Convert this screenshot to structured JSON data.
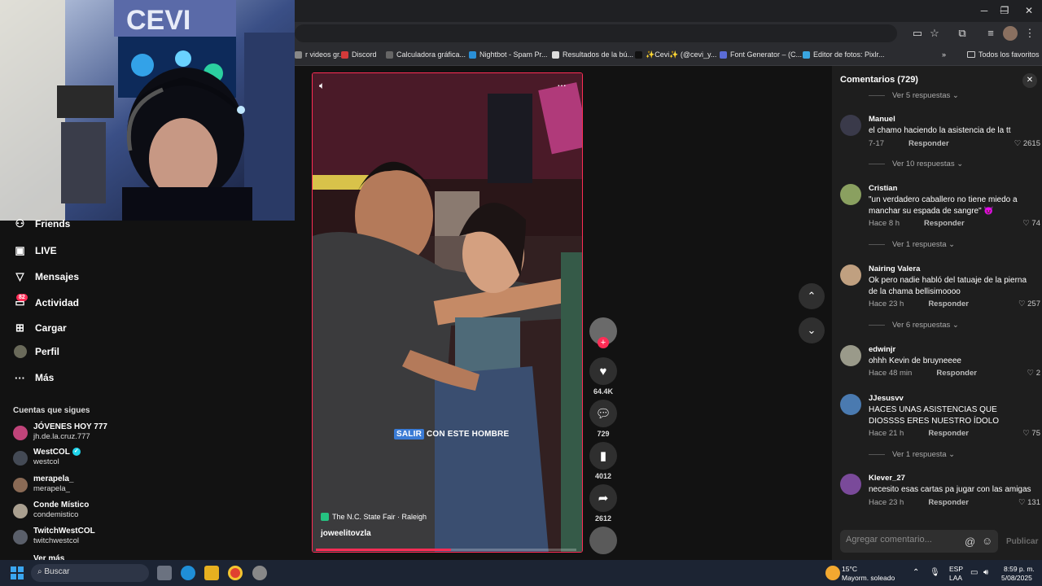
{
  "browser": {
    "bookmarks": [
      {
        "label": "r videos gr...",
        "color": "#888888"
      },
      {
        "label": "Discord",
        "color": "#d33a3a"
      },
      {
        "label": "Calculadora gráfica...",
        "color": "#666666"
      },
      {
        "label": "Nightbot - Spam Pr...",
        "color": "#2a8fd6"
      },
      {
        "label": "Resultados de la bú...",
        "color": "#dddddd"
      },
      {
        "label": "✨Cevi✨ (@cevi_y...",
        "color": "#111111"
      },
      {
        "label": "Font Generator – (C...",
        "color": "#5b6cd6"
      },
      {
        "label": "Editor de fotos: Pixlr...",
        "color": "#3aa6e0"
      }
    ],
    "all_favorites": "Todos los favoritos"
  },
  "sidebar": {
    "nav": [
      {
        "label": "Friends",
        "icon": "friends-icon",
        "glyph": "👥"
      },
      {
        "label": "LIVE",
        "icon": "live-icon",
        "glyph": "▣"
      },
      {
        "label": "Mensajes",
        "icon": "messages-icon",
        "glyph": "✈"
      },
      {
        "label": "Actividad",
        "icon": "activity-icon",
        "glyph": "▭"
      },
      {
        "label": "Cargar",
        "icon": "upload-icon",
        "glyph": "⊞"
      },
      {
        "label": "Perfil",
        "icon": "profile-icon",
        "glyph": "●"
      },
      {
        "label": "Más",
        "icon": "more-icon",
        "glyph": "···"
      }
    ],
    "activity_badge": "82",
    "following_title": "Cuentas que sigues",
    "following": [
      {
        "name": "JÓVENES HOY 777",
        "handle": "jh.de.la.cruz.777",
        "verified": false,
        "color": "#c0447a"
      },
      {
        "name": "WestCOL",
        "handle": "westcol",
        "verified": true,
        "color": "#444a55"
      },
      {
        "name": "merapela_",
        "handle": "merapela_",
        "verified": false,
        "color": "#8a6a55"
      },
      {
        "name": "Conde Místico",
        "handle": "condemistico",
        "verified": false,
        "color": "#aaa090"
      },
      {
        "name": "TwitchWestCOL",
        "handle": "twitchwestcol",
        "verified": false,
        "color": "#5a5f6a"
      },
      {
        "name": "Ver más",
        "handle": "",
        "verified": false,
        "color": "#121212"
      }
    ]
  },
  "video": {
    "caption_highlight": "SALIR",
    "caption_rest": " CON ESTE HOMBRE",
    "location": "The N.C. State Fair · Raleigh",
    "username": "joweelitovzla",
    "progress": 0.52,
    "actions": {
      "likes": "64.4K",
      "comments": "729",
      "saves": "4012",
      "shares": "2612"
    }
  },
  "comments_panel": {
    "title": "Comentarios (729)",
    "input_placeholder": "Agregar comentario...",
    "post_label": "Publicar",
    "reply_label": "Responder",
    "top_replies": "Ver 5 respuestas",
    "comments": [
      {
        "user": "Manuel",
        "text": "el chamo haciendo la asistencia de la tt",
        "time": "7-17",
        "likes": "2615",
        "replies": "Ver 10 respuestas",
        "color": "#3a3a4a"
      },
      {
        "user": "Cristian",
        "text": "\"un verdadero caballero no tiene miedo a manchar su espada de sangre\" 😈",
        "time": "Hace 8 h",
        "likes": "74",
        "replies": "Ver 1 respuesta",
        "color": "#8aa060"
      },
      {
        "user": "Nairing Valera",
        "text": "Ok pero nadie habló del tatuaje de la pierna de la chama bellisimoooo",
        "time": "Hace 23 h",
        "likes": "257",
        "replies": "Ver 6 respuestas",
        "color": "#c0a080"
      },
      {
        "user": "edwinjr",
        "text": "ohhh Kevin de bruyneeee",
        "time": "Hace 48 min",
        "likes": "2",
        "replies": "",
        "color": "#9a9a8a"
      },
      {
        "user": "JJesusvv",
        "text": "HACES UNAS ASISTENCIAS QUE DIOSSSS ERES NUESTRO ÍDOLO",
        "time": "Hace 21 h",
        "likes": "75",
        "replies": "Ver 1 respuesta",
        "color": "#4a7ab0"
      },
      {
        "user": "Klever_27",
        "text": "necesito esas cartas pa jugar con las amigas",
        "time": "Hace 23 h",
        "likes": "131",
        "replies": "",
        "color": "#7a4a9a"
      }
    ]
  },
  "taskbar": {
    "search_placeholder": "Buscar",
    "weather_temp": "15°C",
    "weather_desc": "Mayorm. soleado",
    "lang": "ESP",
    "lang2": "LAA",
    "time": "8:59 p. m.",
    "date": "5/08/2025"
  },
  "webcam_sign": "CEVI"
}
